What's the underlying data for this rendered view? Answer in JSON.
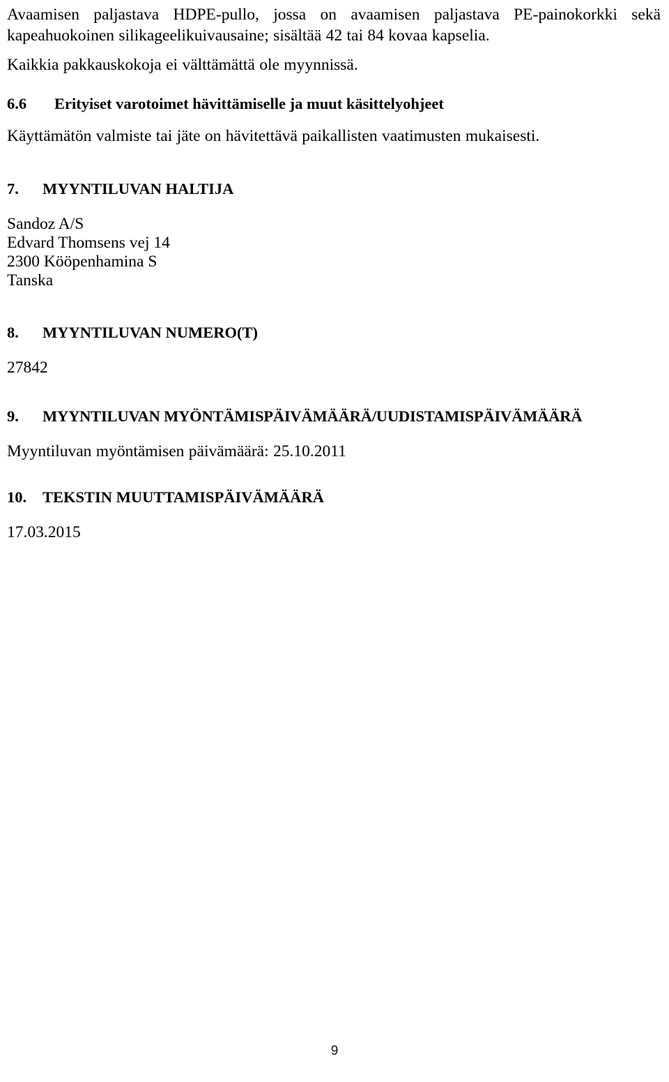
{
  "document": {
    "language": "fi",
    "page_number": "9",
    "paragraphs": {
      "packaging_description": "Avaamisen paljastava HDPE-pullo, jossa on avaamisen paljastava PE-painokorkki sekä kapeahuokoinen silikageelikuivausaine; sisältää 42 tai 84 kovaa kapselia.",
      "pack_sizes_note": "Kaikkia pakkauskokoja ei välttämättä ole myynnissä.",
      "disposal_text": "Käyttämätön valmiste tai jäte on hävitettävä paikallisten vaatimusten mukaisesti.",
      "authorisation_number": "27842",
      "authorisation_granted_date": "Myyntiluvan myöntämisen päivämäärä: 25.10.2011",
      "text_revision_date": "17.03.2015"
    },
    "sections": [
      {
        "number": "6.6",
        "title": "Erityiset varotoimet hävittämiselle ja muut käsittelyohjeet"
      },
      {
        "number": "7.",
        "title": "MYYNTILUVAN HALTIJA"
      },
      {
        "number": "8.",
        "title": "MYYNTILUVAN NUMERO(T)"
      },
      {
        "number": "9.",
        "title": "MYYNTILUVAN MYÖNTÄMISPÄIVÄMÄÄRÄ/UUDISTAMISPÄIVÄMÄÄRÄ"
      },
      {
        "number": "10.",
        "title": "TEKSTIN MUUTTAMISPÄIVÄMÄÄRÄ"
      }
    ],
    "marketing_authorisation_holder": {
      "company": "Sandoz A/S",
      "street": "Edvard Thomsens vej 14",
      "city": "2300 Kööpenhamina S",
      "country": "Tanska"
    }
  }
}
